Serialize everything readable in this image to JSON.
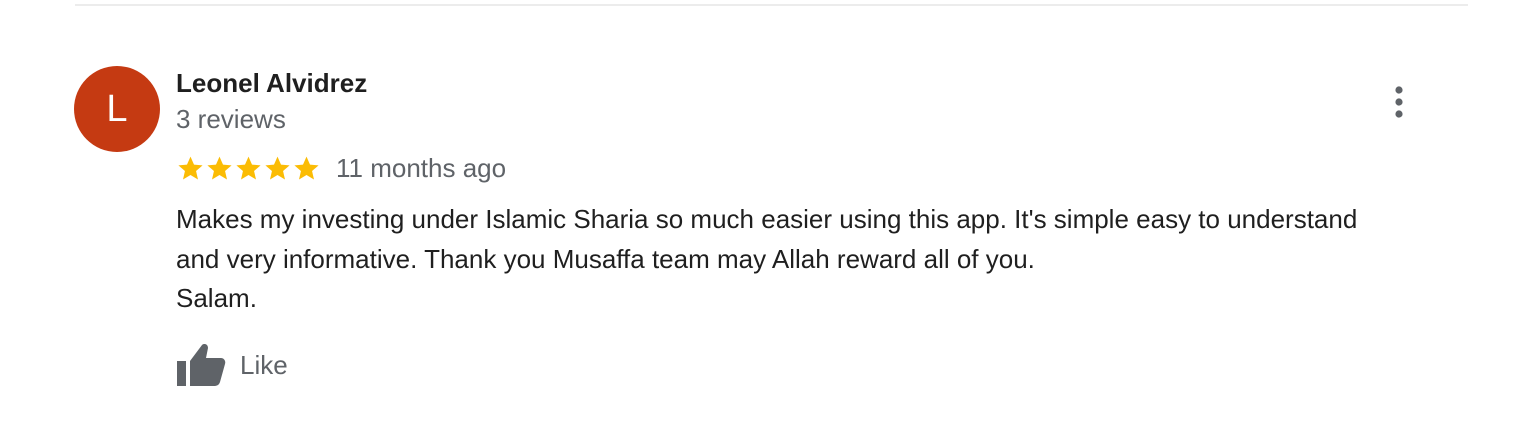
{
  "review": {
    "reviewer_name": "Leonel Alvidrez",
    "avatar_initial": "L",
    "avatar_color": "#c53a12",
    "review_count": "3 reviews",
    "rating": 5,
    "rating_max": 5,
    "star_color": "#fbbc04",
    "date": "11 months ago",
    "text": "Makes my investing under Islamic Sharia so much easier using this app. It's simple easy to understand\nand very informative. Thank you Musaffa team may Allah reward all of you.\nSalam.",
    "like_label": "Like",
    "like_icon": "thumbs-up-icon",
    "menu_icon": "more-vert-icon"
  }
}
